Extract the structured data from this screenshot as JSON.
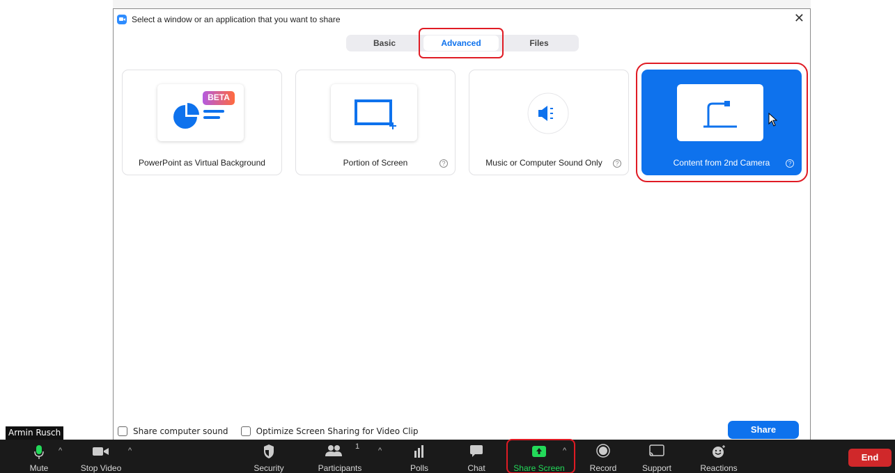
{
  "dialog": {
    "title": "Select a window or an application that you want to share",
    "close_glyph": "✕",
    "tabs": [
      {
        "label": "Basic",
        "active": false
      },
      {
        "label": "Advanced",
        "active": true
      },
      {
        "label": "Files",
        "active": false
      }
    ],
    "cards": [
      {
        "label": "PowerPoint as Virtual Background",
        "badge": "BETA",
        "icon": "powerpoint-chart-icon",
        "help": false
      },
      {
        "label": "Portion of Screen",
        "icon": "screen-portion-icon",
        "help": true
      },
      {
        "label": "Music or Computer Sound Only",
        "icon": "speaker-icon",
        "help": true
      },
      {
        "label": "Content from 2nd Camera",
        "icon": "document-camera-icon",
        "help": true,
        "selected": true
      }
    ],
    "help_glyph": "?",
    "options": {
      "share_sound_label": "Share computer sound",
      "optimize_label": "Optimize Screen Sharing for Video Clip"
    },
    "share_label": "Share"
  },
  "participant_name": "Armin Rusch",
  "toolbar": {
    "mute_label": "Mute",
    "stop_video_label": "Stop Video",
    "security_label": "Security",
    "participants_label": "Participants",
    "participants_count": "1",
    "polls_label": "Polls",
    "chat_label": "Chat",
    "share_screen_label": "Share Screen",
    "record_label": "Record",
    "support_label": "Support",
    "reactions_label": "Reactions",
    "end_label": "End",
    "caret_glyph": "^"
  },
  "colors": {
    "accent": "#0e72ed",
    "highlight": "#e01b24",
    "share_green": "#23d959",
    "end_red": "#d0282a",
    "toolbar_bg": "#1a1a1a"
  }
}
